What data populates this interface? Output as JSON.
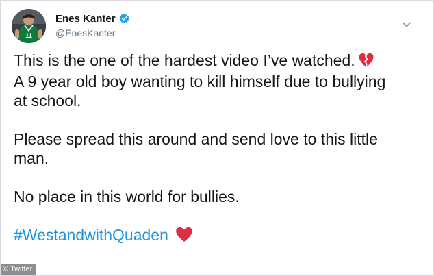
{
  "author": {
    "display_name": "Enes Kanter",
    "handle": "@EnesKanter",
    "verified": true,
    "avatar_jersey_number": "11"
  },
  "tweet": {
    "lines": [
      "This is the one of the hardest video I’ve watched.",
      "A 9 year old boy wanting to kill himself due to bullying",
      "at school.",
      "Please spread this around and send love to this little",
      "man.",
      "No place in this world for bullies."
    ],
    "hashtag": "#WestandwithQuaden",
    "emojis": [
      "broken-heart",
      "red-heart"
    ]
  },
  "icons": {
    "menu": "chevron-down-icon",
    "verified": "verified-badge-icon"
  },
  "colors": {
    "text": "#14171a",
    "secondary": "#657786",
    "link": "#1b95e0",
    "verified": "#1da1f2",
    "heart": "#dd2e44"
  },
  "watermark": {
    "label": "© Twitter"
  }
}
